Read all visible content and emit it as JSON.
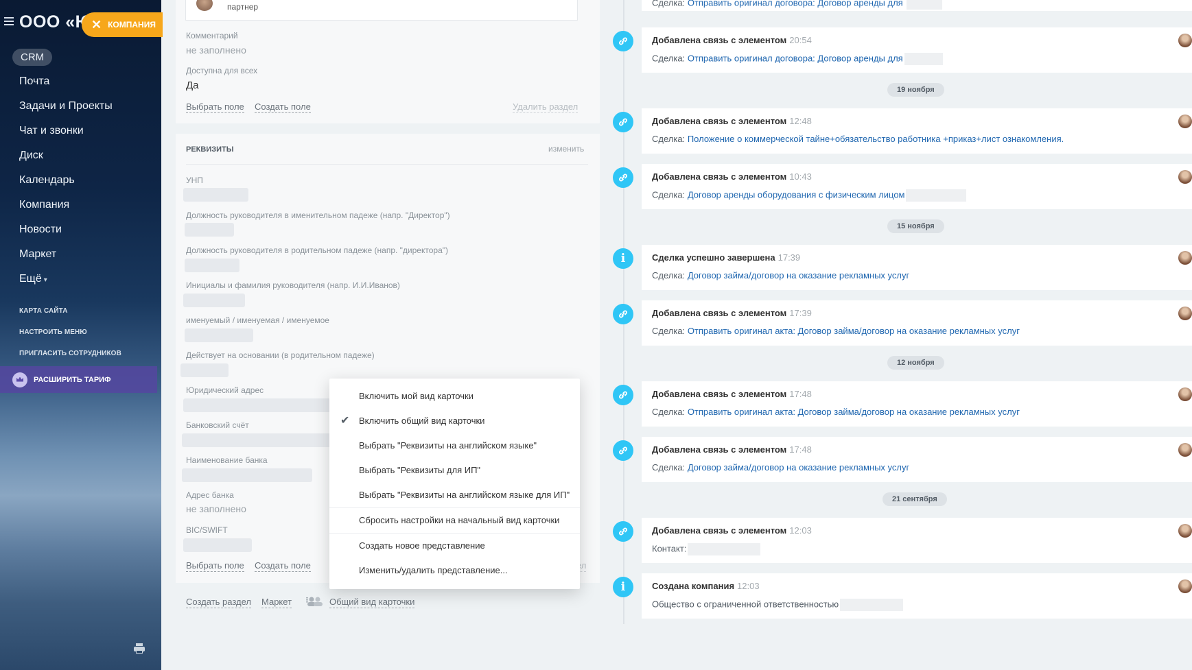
{
  "sidebar": {
    "company_title": "ООО «Ю",
    "company_chip": "КОМПАНИЯ",
    "crm": "CRM",
    "items": [
      {
        "label": "Почта"
      },
      {
        "label": "Задачи и Проекты"
      },
      {
        "label": "Чат и звонки"
      },
      {
        "label": "Диск"
      },
      {
        "label": "Календарь"
      },
      {
        "label": "Компания"
      },
      {
        "label": "Новости"
      },
      {
        "label": "Маркет"
      },
      {
        "label": "Ещё"
      }
    ],
    "small_items": [
      {
        "label": "КАРТА САЙТА"
      },
      {
        "label": "НАСТРОИТЬ МЕНЮ"
      },
      {
        "label": "ПРИГЛАСИТЬ СОТРУДНИКОВ"
      }
    ],
    "upgrade": "РАСШИРИТЬ ТАРИФ"
  },
  "top_card": {
    "partner": "партнер",
    "comment_label": "Комментарий",
    "comment_value": "не заполнено",
    "public_label": "Доступна для всех",
    "public_value": "Да",
    "select_field": "Выбрать поле",
    "create_field": "Создать поле",
    "delete_section": "Удалить раздел"
  },
  "requisites": {
    "title": "РЕКВИЗИТЫ",
    "edit": "изменить",
    "fields": {
      "unp": "УНП",
      "director_nom": "Должность руководителя в именительном падеже (напр. \"Директор\")",
      "director_gen": "Должность руководителя в родительном падеже (напр. \"директора\")",
      "initials": "Инициалы и фамилия руководителя (напр. И.И.Иванов)",
      "named": "именуемый / именуемая / именуемое",
      "basis": "Действует на основании (в родительном падеже)",
      "legal_address": "Юридический адрес",
      "bank_account": "Банковский счёт",
      "bank_name": "Наименование банка",
      "bank_address": "Адрес банка",
      "bank_address_value": "не заполнено",
      "bic": "BIC/SWIFT"
    },
    "select_field": "Выбрать поле",
    "create_field": "Создать поле",
    "delete_partial": "ел"
  },
  "bottom": {
    "create_section": "Создать раздел",
    "market": "Маркет",
    "common_view": "Общий вид карточки"
  },
  "menu": {
    "items": [
      {
        "label": "Включить мой вид карточки"
      },
      {
        "label": "Включить общий вид карточки"
      },
      {
        "label": "Выбрать \"Реквизиты на английском языке\""
      },
      {
        "label": "Выбрать \"Реквизиты для ИП\""
      },
      {
        "label": "Выбрать \"Реквизиты на английском языке для ИП\""
      },
      {
        "label": "Сбросить настройки на начальный вид карточки"
      },
      {
        "label": "Создать новое представление"
      },
      {
        "label": "Изменить/удалить представление..."
      }
    ]
  },
  "timeline": {
    "first_partial": {
      "prefix": "Сделка:",
      "link": "Отправить оригинал договора: Договор аренды для"
    },
    "events": [
      {
        "title": "Добавлена связь с элементом",
        "time": "20:54",
        "prefix": "Сделка:",
        "link": "Отправить оригинал договора: Договор аренды для",
        "icon": "link-icon"
      },
      {
        "title": "Добавлена связь с элементом",
        "time": "12:48",
        "prefix": "Сделка:",
        "link": "Положение о коммерческой тайне+обязательство работника +приказ+лист ознакомления.",
        "icon": "link-icon"
      },
      {
        "title": "Добавлена связь с элементом",
        "time": "10:43",
        "prefix": "Сделка:",
        "link": "Договор аренды оборудования с физическим лицом",
        "icon": "link-icon"
      },
      {
        "title": "Сделка успешно завершена",
        "time": "17:39",
        "prefix": "Сделка:",
        "link": "Договор займа/договор на оказание рекламных услуг",
        "icon": "info-icon"
      },
      {
        "title": "Добавлена связь с элементом",
        "time": "17:39",
        "prefix": "Сделка:",
        "link": "Отправить оригинал акта: Договор займа/договор на оказание рекламных услуг",
        "icon": "link-icon"
      },
      {
        "title": "Добавлена связь с элементом",
        "time": "17:48",
        "prefix": "Сделка:",
        "link": "Отправить оригинал акта: Договор займа/договор на оказание рекламных услуг",
        "icon": "link-icon"
      },
      {
        "title": "Добавлена связь с элементом",
        "time": "17:48",
        "prefix": "Сделка:",
        "link": "Договор займа/договор на оказание рекламных услуг",
        "icon": "link-icon"
      },
      {
        "title": "Добавлена связь с элементом",
        "time": "12:03",
        "prefix": "Контакт:",
        "link": "",
        "icon": "link-icon"
      },
      {
        "title": "Создана компания",
        "time": "12:03",
        "prefix": "Общество с ограниченной ответственностью",
        "link": "",
        "icon": "info-icon"
      }
    ],
    "dates": [
      "19 ноября",
      "15 ноября",
      "12 ноября",
      "21 сентября"
    ]
  },
  "colors": {
    "accent": "#2fc6f6",
    "chip": "#f7a71b",
    "link": "#2067b0"
  }
}
